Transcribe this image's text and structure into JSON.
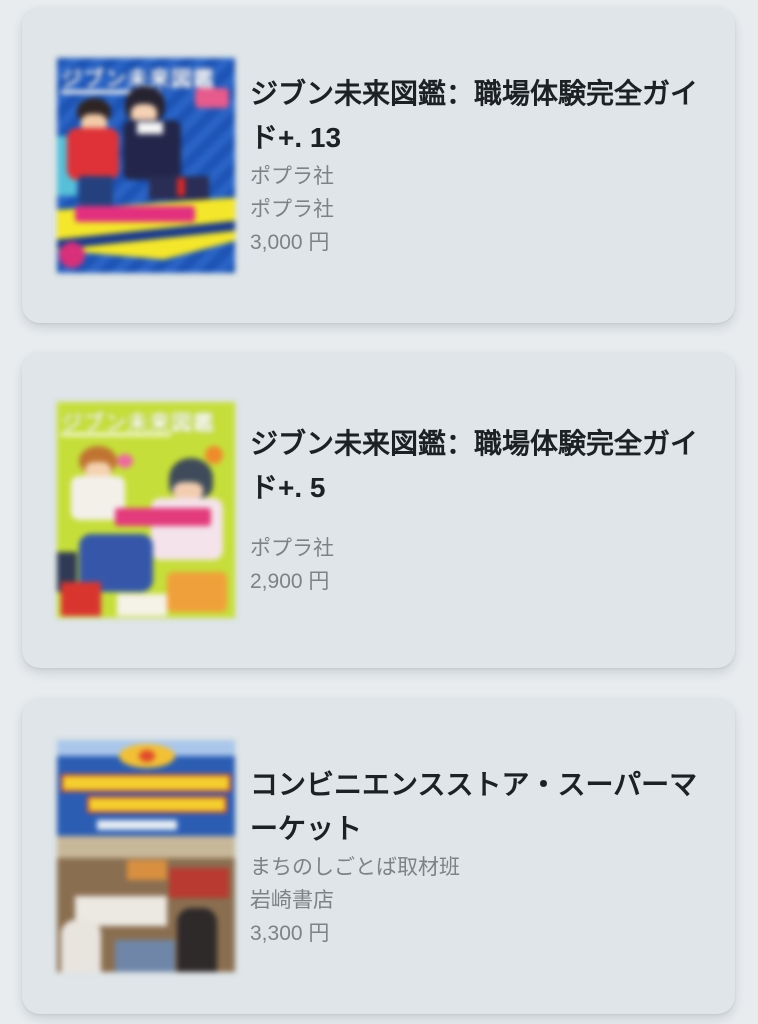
{
  "colors": {
    "page_background": "#e8ecef",
    "card_background": "#dfe5e8",
    "title_text": "#1e2124",
    "meta_text": "#7e8286"
  },
  "books": [
    {
      "title": "ジブン未来図鑑：職場体験完全ガイド+. 13",
      "author": "ポプラ社",
      "publisher": "ポプラ社",
      "price": "3,000 円",
      "cover_text": "ジブン未来図鑑"
    },
    {
      "title": "ジブン未来図鑑：職場体験完全ガイド+. 5",
      "author": "",
      "publisher": "ポプラ社",
      "price": "2,900 円",
      "cover_text": "ジブン未来図鑑"
    },
    {
      "title": "コンビニエンスストア・スーパーマーケット",
      "author": "まちのしごとば取材班",
      "publisher": "岩崎書店",
      "price": "3,300 円"
    }
  ]
}
